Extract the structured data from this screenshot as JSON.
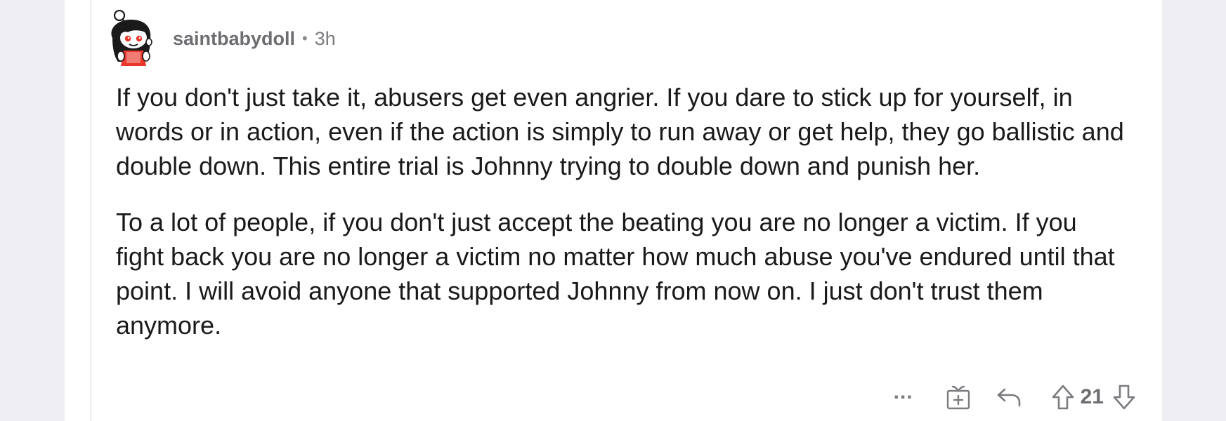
{
  "comment": {
    "username": "saintbabydoll",
    "separator": "•",
    "timestamp": "3h",
    "paragraphs": [
      "If you don't just take it, abusers get even angrier. If you dare to stick up for yourself, in words or in action, even if the action is simply to run away or get help, they go ballistic and double down. This entire trial is Johnny trying to double down and punish her.",
      "To a lot of people, if you don't just accept the beating you are no longer a victim. If you fight back you are no longer a victim no matter how much abuse you've endured until that point. I will avoid anyone that supported Johnny from now on. I just don't trust them anymore."
    ]
  },
  "actions": {
    "more_label": "...",
    "vote_count": "21",
    "icons": [
      "ellipsis-icon",
      "award-icon",
      "reply-icon",
      "upvote-icon",
      "downvote-icon"
    ]
  },
  "colors": {
    "background": "#efeff3",
    "card": "#ffffff",
    "text": "#1a1a1b",
    "meta": "#7b7b80",
    "avatar_accent": "#e8372b"
  }
}
